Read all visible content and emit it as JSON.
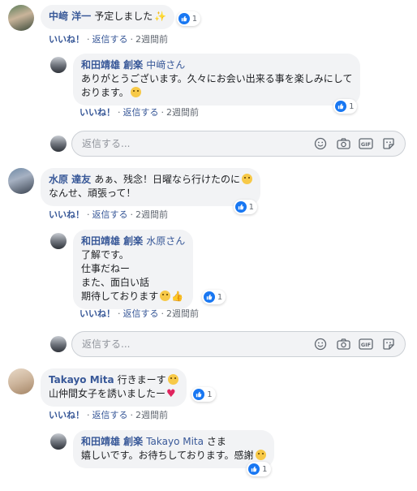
{
  "actions": {
    "like": "いいね！",
    "reply": "返信する",
    "dot": "·"
  },
  "reply_placeholder": "返信する...",
  "colors": {
    "name": "#385898",
    "like": "#1877f2",
    "bubble": "#f2f3f5"
  },
  "comments": [
    {
      "author": "中﨑 洋一",
      "lines": [
        "予定しました"
      ],
      "emoji": "sparkle",
      "likes": "1",
      "time": "2週間前",
      "reply": {
        "author": "和田靖雄 創楽",
        "mention": "中﨑さん",
        "lines": [
          "ありがとうございます。久々にお会い出来る事を楽しみにして",
          "おります。"
        ],
        "emoji": "smile",
        "likes": "1",
        "time": "2週間前"
      }
    },
    {
      "author": "水原 達友",
      "lines": [
        "あぁ、残念！日曜なら行けたのに",
        "なんせ、頑張って！"
      ],
      "emoji": "laugh",
      "likes": "1",
      "time": "2週間前",
      "reply": {
        "author": "和田靖雄 創楽",
        "mention": "水原さん",
        "lines": [
          "了解です。",
          "仕事だねー",
          "また、面白い話",
          "期待しております"
        ],
        "emoji": "smile-thumb",
        "likes": "1",
        "time": "2週間前"
      }
    },
    {
      "author": "Takayo Mita",
      "lines": [
        "行きまーす",
        "山仲間女子を誘いましたー"
      ],
      "emoji": "smile-heart",
      "likes": "1",
      "time": "2週間前",
      "reply": {
        "author": "和田靖雄 創楽",
        "mention": "Takayo Mita",
        "lines_suffix": "さま",
        "lines": [
          "嬉しいです。お待ちしております。感謝"
        ],
        "emoji": "smile",
        "likes": "1"
      }
    }
  ]
}
